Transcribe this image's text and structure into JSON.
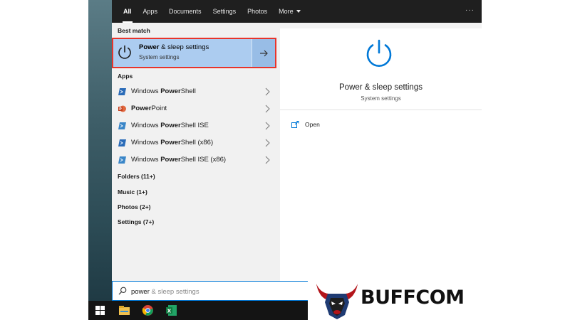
{
  "filter_tabs": [
    {
      "label": "All",
      "active": true
    },
    {
      "label": "Apps",
      "active": false
    },
    {
      "label": "Documents",
      "active": false
    },
    {
      "label": "Settings",
      "active": false
    },
    {
      "label": "Photos",
      "active": false
    },
    {
      "label": "More",
      "active": false
    }
  ],
  "more_options_glyph": "···",
  "best_match": {
    "section_label": "Best match",
    "title_bold": "Power",
    "title_rest": " & sleep settings",
    "subtitle": "System settings",
    "icon": "power-icon"
  },
  "apps": {
    "section_label": "Apps",
    "items": [
      {
        "pre": "Windows ",
        "bold": "Power",
        "post": "Shell",
        "icon": "powershell-icon"
      },
      {
        "pre": "",
        "bold": "Power",
        "post": "Point",
        "icon": "powerpoint-icon"
      },
      {
        "pre": "Windows ",
        "bold": "Power",
        "post": "Shell ISE",
        "icon": "powershell-ise-icon"
      },
      {
        "pre": "Windows ",
        "bold": "Power",
        "post": "Shell (x86)",
        "icon": "powershell-icon"
      },
      {
        "pre": "Windows ",
        "bold": "Power",
        "post": "Shell ISE (x86)",
        "icon": "powershell-ise-icon"
      }
    ]
  },
  "groups": [
    {
      "label": "Folders (11+)"
    },
    {
      "label": "Music (1+)"
    },
    {
      "label": "Photos (2+)"
    },
    {
      "label": "Settings (7+)"
    }
  ],
  "detail": {
    "title": "Power & sleep settings",
    "subtitle": "System settings",
    "open_label": "Open"
  },
  "search": {
    "typed": "power",
    "completion": " & sleep settings"
  },
  "taskbar": {
    "items": [
      "windows-start-icon",
      "file-explorer-icon",
      "chrome-icon",
      "excel-icon"
    ]
  },
  "logo": {
    "text": "BUFFCOM"
  },
  "colors": {
    "accent": "#0078d7",
    "best_match_bg": "#acccf0",
    "highlight_border": "#e8342b",
    "topbar_bg": "#1f1f1f",
    "taskbar_bg": "#141414"
  }
}
